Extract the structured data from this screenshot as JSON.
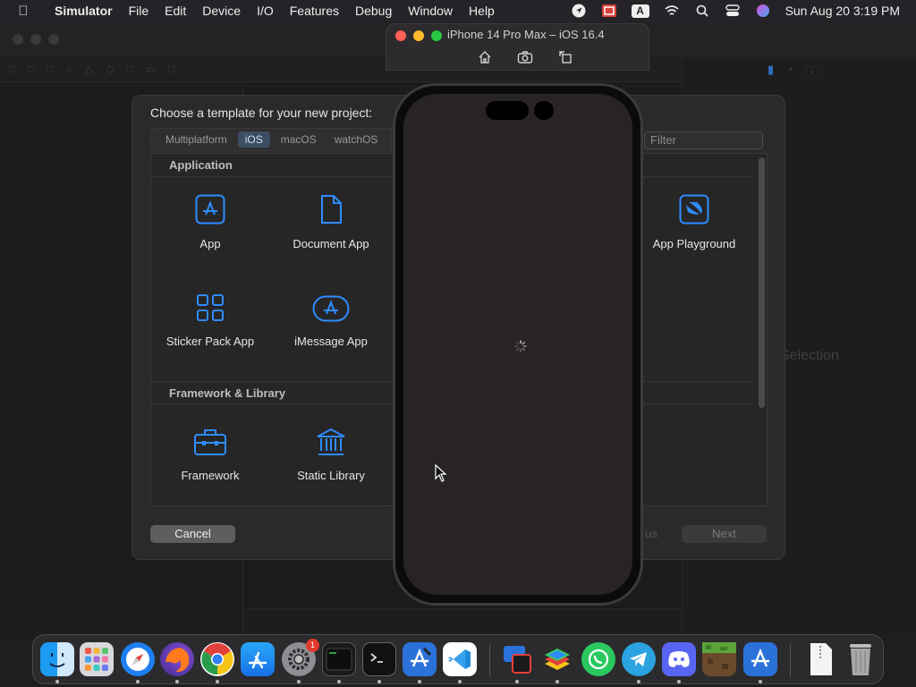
{
  "menubar": {
    "app": "Simulator",
    "items": [
      "File",
      "Edit",
      "Device",
      "I/O",
      "Features",
      "Debug",
      "Window",
      "Help"
    ],
    "clock": "Sun Aug 20  3:19 PM",
    "input_source": "A"
  },
  "xcode": {
    "no_selection": "Selection"
  },
  "sheet": {
    "title": "Choose a template for your new project:",
    "tabs": [
      "Multiplatform",
      "iOS",
      "macOS",
      "watchOS"
    ],
    "active_tab": "iOS",
    "filter_placeholder": "Filter",
    "sections": [
      {
        "title": "Application",
        "templates": [
          "App",
          "Document App",
          "App Playground",
          "Sticker Pack App",
          "iMessage App"
        ]
      },
      {
        "title": "Framework & Library",
        "templates": [
          "Framework",
          "Static Library"
        ]
      }
    ],
    "cancel_label": "Cancel",
    "previous_label": "us",
    "next_label": "Next"
  },
  "simulator": {
    "title": "iPhone 14 Pro Max – iOS 16.4"
  },
  "dock": {
    "apps": [
      "Finder",
      "Launchpad",
      "Safari",
      "Firefox",
      "Chrome",
      "App Store",
      "System Settings",
      "Activity Monitor",
      "Terminal",
      "Xcode",
      "Visual Studio Code",
      "Simulator",
      "BlueStacks",
      "WhatsApp",
      "Telegram",
      "Discord",
      "Minecraft",
      "Xcode Installer",
      "Archive",
      "Trash"
    ],
    "settings_badge": "1"
  },
  "colors": {
    "accent": "#2f8cff",
    "icon_blue": "#2f8cff",
    "close": "#ff5f57",
    "minimize": "#febc2e",
    "zoom": "#28c840"
  }
}
